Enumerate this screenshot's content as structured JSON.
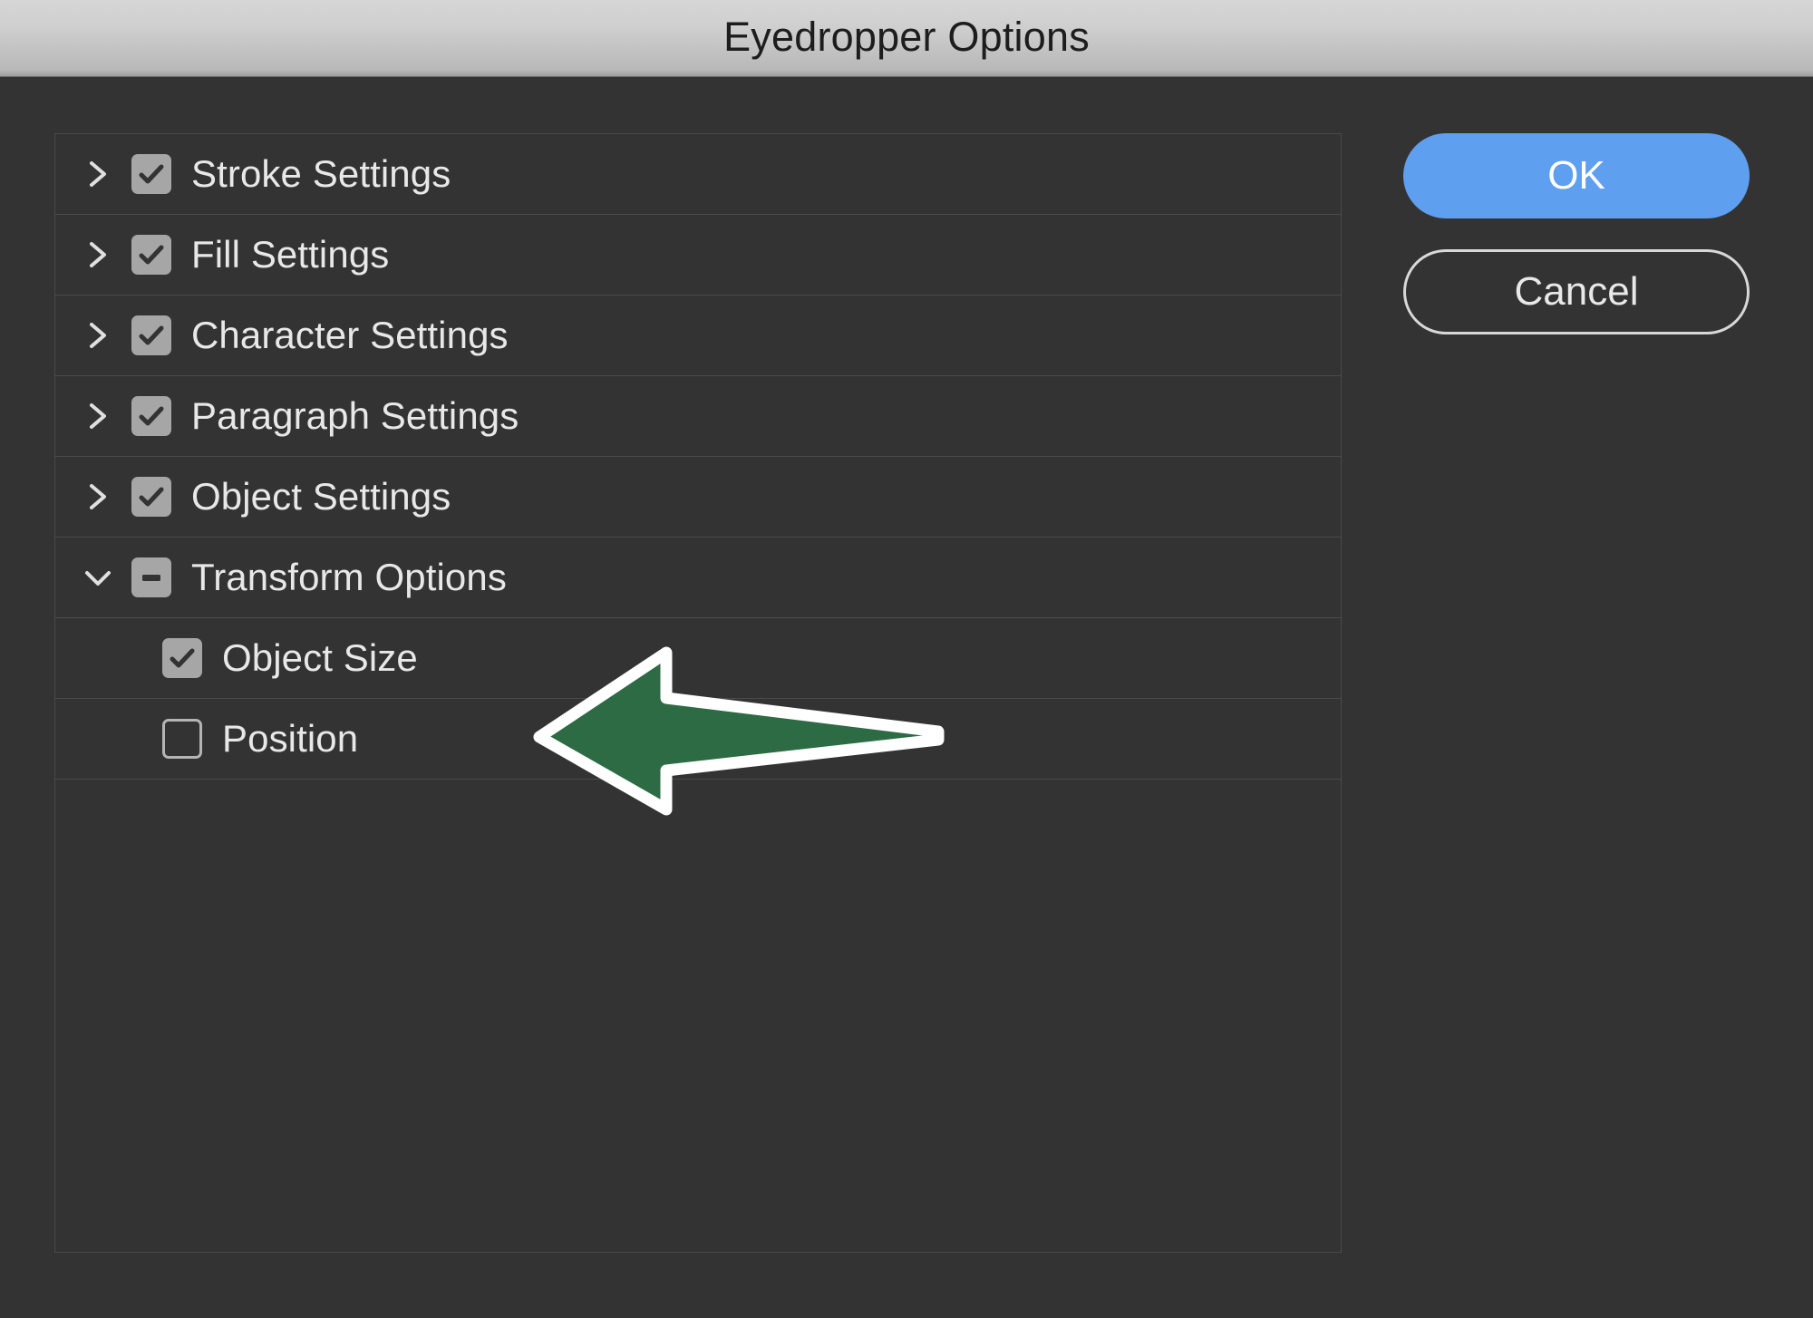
{
  "window": {
    "title": "Eyedropper Options"
  },
  "colors": {
    "dialog_background": "#333333",
    "titlebar_gradient_top": "#d6d6d6",
    "titlebar_gradient_bottom": "#9e9e9e",
    "titlebar_text": "#1d1d1d",
    "row_text": "#e8e8e8",
    "row_separator": "#4a4a4a",
    "checkbox_fill": "#a6a6a6",
    "checkbox_glyph": "#333333",
    "checkbox_unchecked_border": "#b4b4b4",
    "ok_button_background": "#5f9ff0",
    "ok_button_text": "#ffffff",
    "cancel_button_border": "#d8d8d8",
    "cancel_button_text": "#e8e8e8",
    "annotation_arrow_fill": "#2d6b44",
    "annotation_arrow_outline": "#ffffff"
  },
  "settings_list": {
    "rows": [
      {
        "label": "Stroke Settings",
        "checkbox_state": "checked",
        "disclosure": "collapsed",
        "level": 0,
        "icon": "chevron-right-icon"
      },
      {
        "label": "Fill Settings",
        "checkbox_state": "checked",
        "disclosure": "collapsed",
        "level": 0,
        "icon": "chevron-right-icon"
      },
      {
        "label": "Character Settings",
        "checkbox_state": "checked",
        "disclosure": "collapsed",
        "level": 0,
        "icon": "chevron-right-icon"
      },
      {
        "label": "Paragraph Settings",
        "checkbox_state": "checked",
        "disclosure": "collapsed",
        "level": 0,
        "icon": "chevron-right-icon"
      },
      {
        "label": "Object Settings",
        "checkbox_state": "checked",
        "disclosure": "collapsed",
        "level": 0,
        "icon": "chevron-right-icon"
      },
      {
        "label": "Transform Options",
        "checkbox_state": "mixed",
        "disclosure": "expanded",
        "level": 0,
        "icon": "chevron-down-icon"
      },
      {
        "label": "Object Size",
        "checkbox_state": "checked",
        "disclosure": "none",
        "level": 1,
        "icon": ""
      },
      {
        "label": "Position",
        "checkbox_state": "unchecked",
        "disclosure": "none",
        "level": 1,
        "icon": ""
      }
    ]
  },
  "buttons": {
    "ok_label": "OK",
    "cancel_label": "Cancel"
  },
  "annotation": {
    "type": "arrow",
    "direction": "left",
    "points_at": "Object Size"
  }
}
